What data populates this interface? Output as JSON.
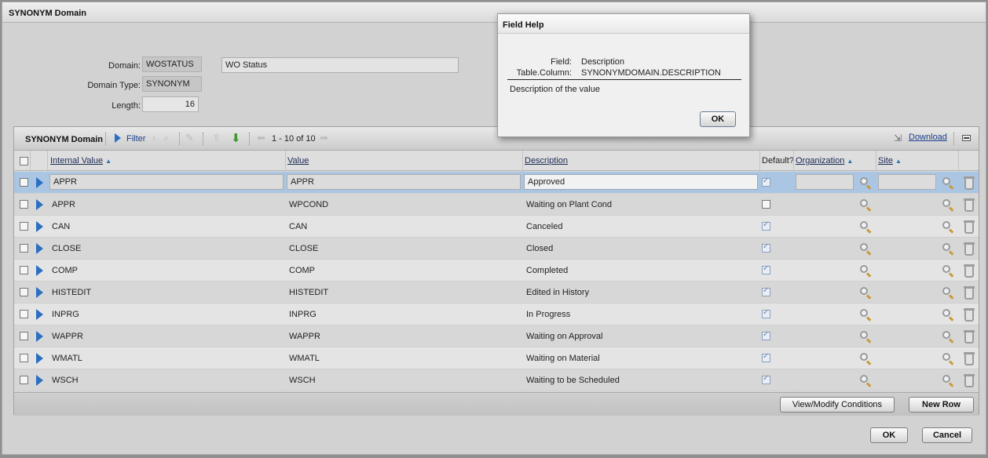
{
  "dialog": {
    "title": "SYNONYM Domain",
    "ok_label": "OK",
    "cancel_label": "Cancel"
  },
  "form": {
    "domain_label": "Domain:",
    "domain_value": "WOSTATUS",
    "domain_description": "WO Status",
    "domain_type_label": "Domain Type:",
    "domain_type_value": "SYNONYM",
    "length_label": "Length:",
    "length_value": "16"
  },
  "table": {
    "title": "SYNONYM Domain",
    "filter_label": "Filter",
    "pagination": "1 - 10 of 10",
    "download_label": "Download",
    "columns": {
      "internal_value": "Internal Value",
      "value": "Value",
      "description": "Description",
      "default": "Default?",
      "organization": "Organization",
      "site": "Site"
    },
    "rows": [
      {
        "internal": "APPR",
        "value": "APPR",
        "description": "Approved",
        "default": true
      },
      {
        "internal": "APPR",
        "value": "WPCOND",
        "description": "Waiting on Plant Cond",
        "default": false
      },
      {
        "internal": "CAN",
        "value": "CAN",
        "description": "Canceled",
        "default": true
      },
      {
        "internal": "CLOSE",
        "value": "CLOSE",
        "description": "Closed",
        "default": true
      },
      {
        "internal": "COMP",
        "value": "COMP",
        "description": "Completed",
        "default": true
      },
      {
        "internal": "HISTEDIT",
        "value": "HISTEDIT",
        "description": "Edited in History",
        "default": true
      },
      {
        "internal": "INPRG",
        "value": "INPRG",
        "description": "In Progress",
        "default": true
      },
      {
        "internal": "WAPPR",
        "value": "WAPPR",
        "description": "Waiting on Approval",
        "default": true
      },
      {
        "internal": "WMATL",
        "value": "WMATL",
        "description": "Waiting on Material",
        "default": true
      },
      {
        "internal": "WSCH",
        "value": "WSCH",
        "description": "Waiting to be Scheduled",
        "default": true
      }
    ],
    "view_modify_label": "View/Modify Conditions",
    "new_row_label": "New Row"
  },
  "field_help": {
    "title": "Field Help",
    "field_label": "Field:",
    "field_value": "Description",
    "table_column_label": "Table.Column:",
    "table_column_value": "SYNONYMDOMAIN.DESCRIPTION",
    "help_text": "Description of the value",
    "ok_label": "OK"
  },
  "colors": {
    "selected_row": "#aac6e3",
    "link": "#1b3f8c",
    "row_arrow": "#2b6fc2",
    "next_page_arrow": "#3a9a2a"
  },
  "icons": [
    "filter-arrow-icon",
    "find-icon",
    "edit-icon",
    "prev-page-icon",
    "next-page-icon",
    "download-icon",
    "magnifier-icon",
    "trash-icon",
    "collapse-icon"
  ]
}
